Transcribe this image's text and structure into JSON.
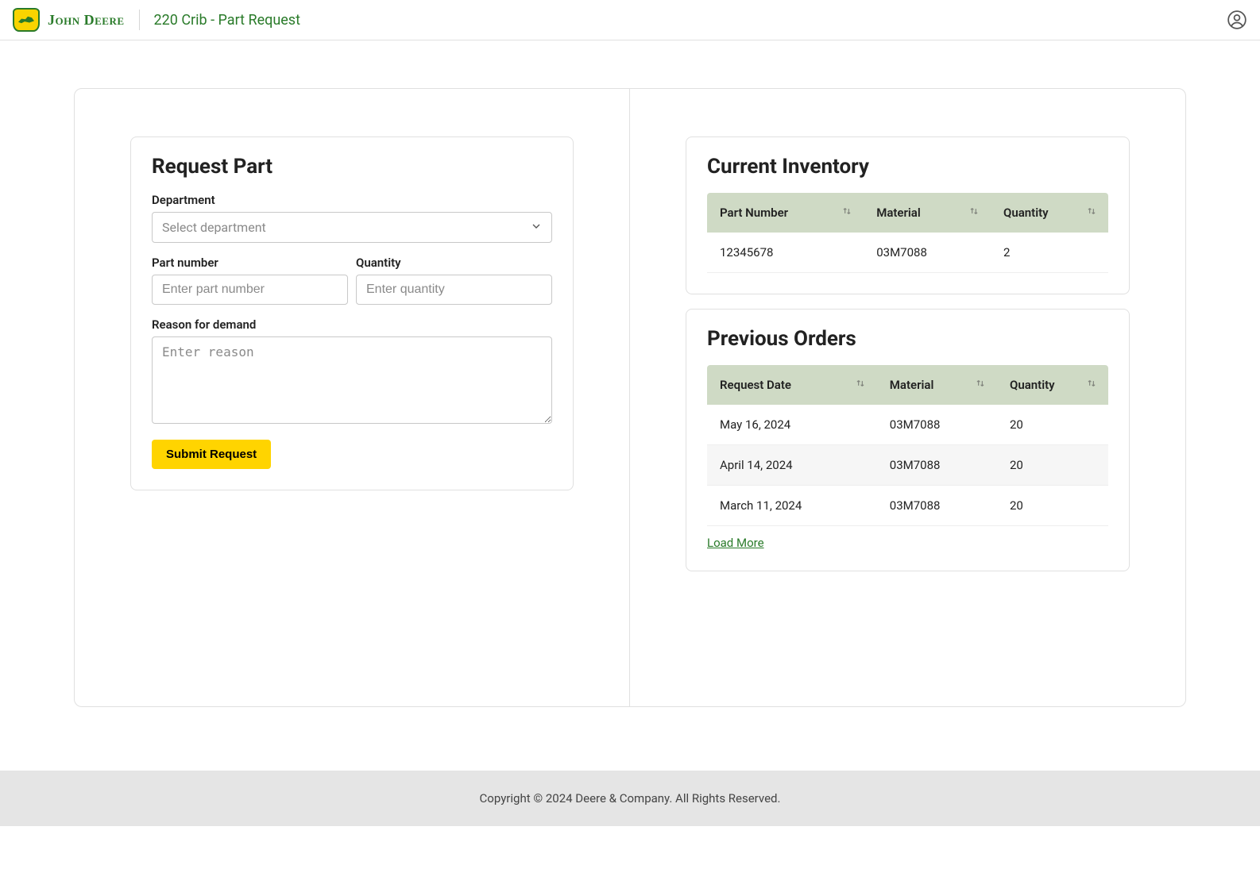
{
  "header": {
    "brand": "John Deere",
    "page_title": "220 Crib - Part Request"
  },
  "request_form": {
    "title": "Request Part",
    "department_label": "Department",
    "department_placeholder": "Select department",
    "part_number_label": "Part number",
    "part_number_placeholder": "Enter part number",
    "quantity_label": "Quantity",
    "quantity_placeholder": "Enter quantity",
    "reason_label": "Reason for demand",
    "reason_placeholder": "Enter reason",
    "submit_label": "Submit Request"
  },
  "inventory": {
    "title": "Current Inventory",
    "columns": [
      "Part Number",
      "Material",
      "Quantity"
    ],
    "rows": [
      {
        "part_number": "12345678",
        "material": "03M7088",
        "quantity": "2"
      }
    ]
  },
  "orders": {
    "title": "Previous Orders",
    "columns": [
      "Request Date",
      "Material",
      "Quantity"
    ],
    "rows": [
      {
        "date": "May 16, 2024",
        "material": "03M7088",
        "quantity": "20"
      },
      {
        "date": "April 14, 2024",
        "material": "03M7088",
        "quantity": "20"
      },
      {
        "date": "March 11, 2024",
        "material": "03M7088",
        "quantity": "20"
      }
    ],
    "load_more": "Load More"
  },
  "footer": {
    "copyright": "Copyright © 2024 Deere & Company. All Rights Reserved."
  }
}
